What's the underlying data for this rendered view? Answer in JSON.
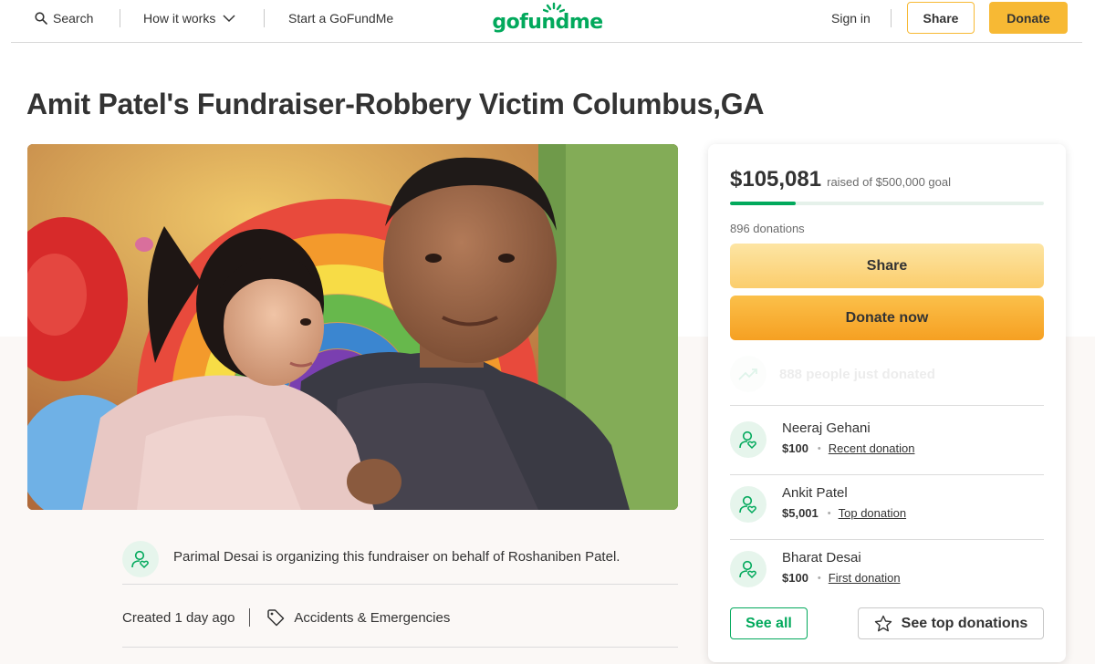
{
  "nav": {
    "search_label": "Search",
    "how_it_works_label": "How it works",
    "start_label": "Start a GoFundMe",
    "logo_text": "gofundme",
    "signin_label": "Sign in",
    "share_label": "Share",
    "donate_label": "Donate"
  },
  "fundraiser": {
    "title": "Amit Patel's Fundraiser-Robbery Victim Columbus,GA",
    "organizer_text": "Parimal Desai is organizing this fundraiser on behalf of Roshaniben Patel.",
    "created_label": "Created 1 day ago",
    "category": "Accidents & Emergencies"
  },
  "donation_card": {
    "raised_amount": "$105,081",
    "raised_goal_text": "raised of $500,000 goal",
    "progress_fraction": 0.21,
    "donation_count": "896 donations",
    "share_label": "Share",
    "donate_label": "Donate now",
    "just_donated_text": "888 people just donated",
    "donors": [
      {
        "name": "Neeraj Gehani",
        "amount": "$100",
        "tag": "Recent donation"
      },
      {
        "name": "Ankit Patel",
        "amount": "$5,001",
        "tag": "Top donation"
      },
      {
        "name": "Bharat Desai",
        "amount": "$100",
        "tag": "First donation"
      }
    ],
    "see_all_label": "See all",
    "see_top_label": "See top donations"
  },
  "colors": {
    "brand_green": "#02a95c",
    "accent_yellow": "#f7b934",
    "donate_orange": "#f6a022"
  }
}
